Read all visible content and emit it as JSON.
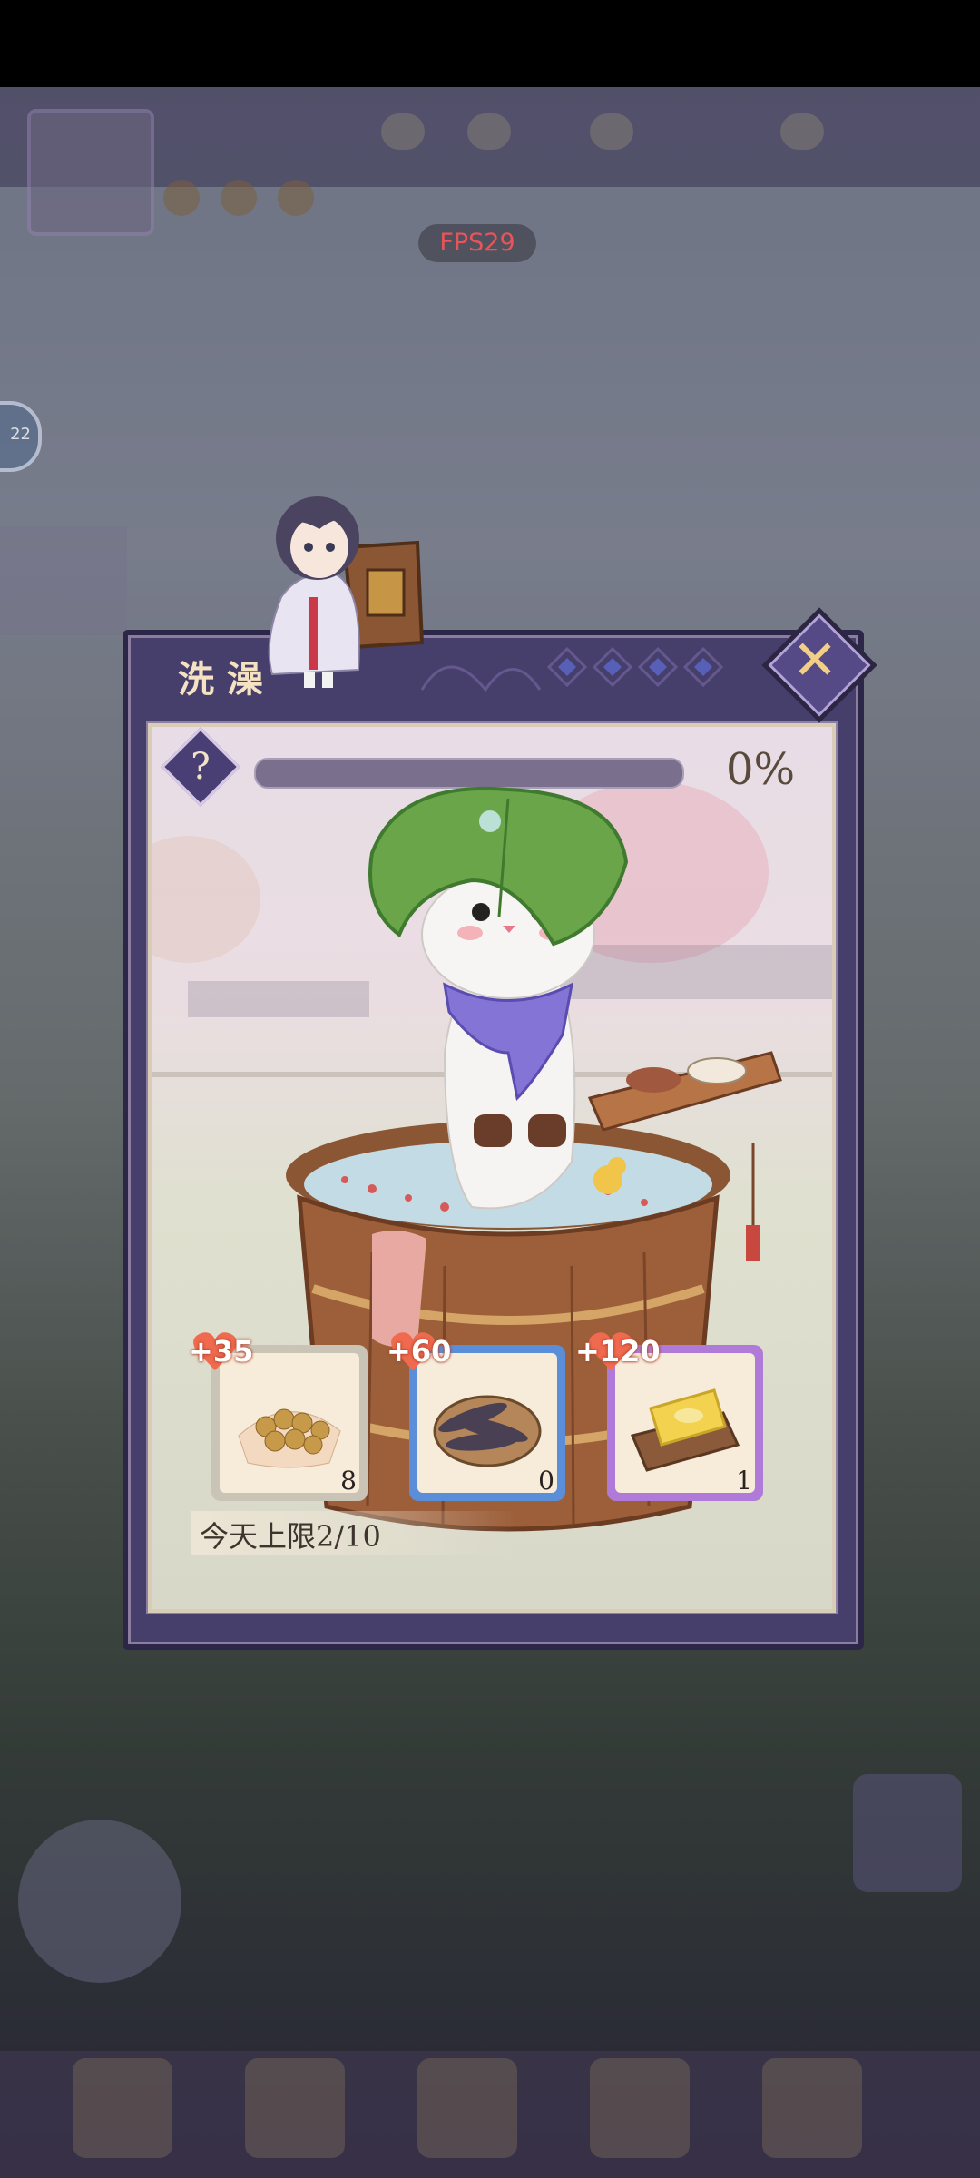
{
  "fps_label": "FPS29",
  "side_button_label": "22",
  "dialog": {
    "title": "洗澡",
    "help_label": "?",
    "progress": {
      "value": 0,
      "label": "0%"
    },
    "close_label": "✕",
    "items": [
      {
        "name": "item-1",
        "bonus": "+35",
        "count": "8",
        "frame_color": "#c9c4b6"
      },
      {
        "name": "item-2",
        "bonus": "+60",
        "count": "0",
        "frame_color": "#5a8ed8"
      },
      {
        "name": "item-3",
        "bonus": "+120",
        "count": "1",
        "frame_color": "#b07ad8"
      }
    ],
    "daily_limit": "今天上限2/10"
  },
  "colors": {
    "dialog_frame": "#463f6b",
    "accent_gold": "#f2cf87",
    "heart": "#ef6a4e"
  }
}
